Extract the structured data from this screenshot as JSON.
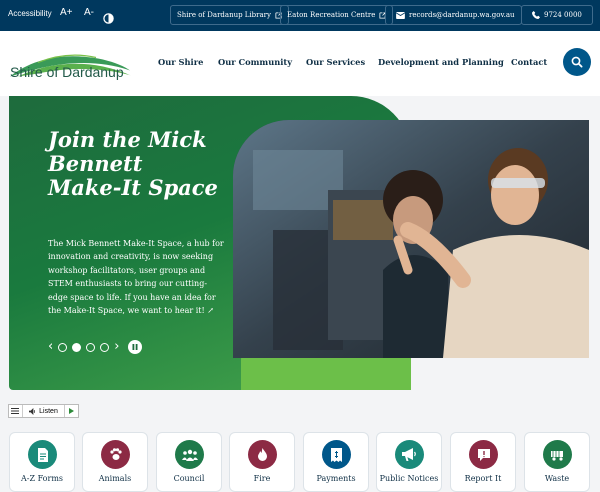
{
  "topbar": {
    "accessibility_label": "Accessibility",
    "increase_font": "A+",
    "decrease_font": "A-",
    "links": [
      {
        "label": "Shire of Dardanup Library"
      },
      {
        "label": "Eaton Recreation Centre"
      },
      {
        "label": "records@dardanup.wa.gov.au"
      },
      {
        "label": "9724 0000"
      }
    ]
  },
  "header": {
    "logo_text": "Shire of Dardanup",
    "nav": [
      "Our Shire",
      "Our Community",
      "Our Services",
      "Development and Planning",
      "Contact"
    ]
  },
  "hero": {
    "title": "Join the Mick Bennett Make-It Space",
    "body": "The Mick Bennett Make-It Space, a hub for innovation and creativity, is now seeking workshop facilitators, user groups and STEM enthusiasts to bring our cutting-edge space to life. If you have an idea for the Make-It Space, we want to hear it! ↗",
    "slides": 4,
    "active_slide": 2
  },
  "listen": {
    "label": "Listen"
  },
  "quick_links": [
    {
      "label": "A-Z Forms",
      "icon": "document-icon",
      "color": "#1a8a7a"
    },
    {
      "label": "Animals",
      "icon": "paw-icon",
      "color": "#8c2a44"
    },
    {
      "label": "Council",
      "icon": "people-icon",
      "color": "#1f7a4a"
    },
    {
      "label": "Fire",
      "icon": "flame-icon",
      "color": "#8c2a44"
    },
    {
      "label": "Payments",
      "icon": "receipt-icon",
      "color": "#00578a"
    },
    {
      "label": "Public Notices",
      "icon": "megaphone-icon",
      "color": "#1a8a7a"
    },
    {
      "label": "Report It",
      "icon": "alert-icon",
      "color": "#8c2a44"
    },
    {
      "label": "Waste",
      "icon": "truck-icon",
      "color": "#1f7a4a"
    }
  ],
  "colors": {
    "topbar": "#00385e",
    "accent": "#00578a",
    "hero_green": "#1e6b3d"
  }
}
